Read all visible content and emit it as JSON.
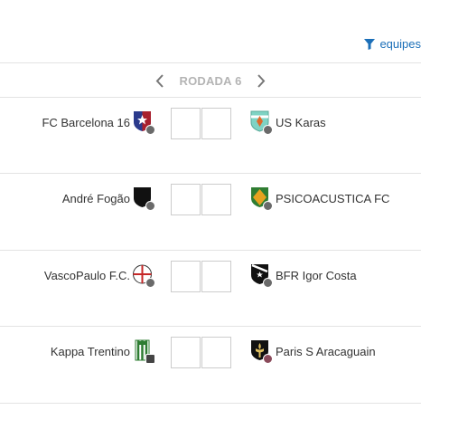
{
  "filter": {
    "label": "equipes",
    "icon": "filter-icon"
  },
  "round": {
    "title": "RODADA 6",
    "prev_icon": "chevron-left-icon",
    "next_icon": "chevron-right-icon"
  },
  "matches": [
    {
      "home": {
        "name": "FC Barcelona 16"
      },
      "away": {
        "name": "US Karas"
      },
      "home_score": "",
      "away_score": ""
    },
    {
      "home": {
        "name": "André Fogão"
      },
      "away": {
        "name": "PSICOACUSTICA FC"
      },
      "home_score": "",
      "away_score": ""
    },
    {
      "home": {
        "name": "VascoPaulo F.C."
      },
      "away": {
        "name": "BFR Igor Costa"
      },
      "home_score": "",
      "away_score": ""
    },
    {
      "home": {
        "name": "Kappa Trentino"
      },
      "away": {
        "name": "Paris S Aracaguain"
      },
      "home_score": "",
      "away_score": ""
    }
  ],
  "colors": {
    "accent": "#1b6fb8",
    "divider": "#e3e3e3",
    "muted": "#b4b4b4"
  }
}
